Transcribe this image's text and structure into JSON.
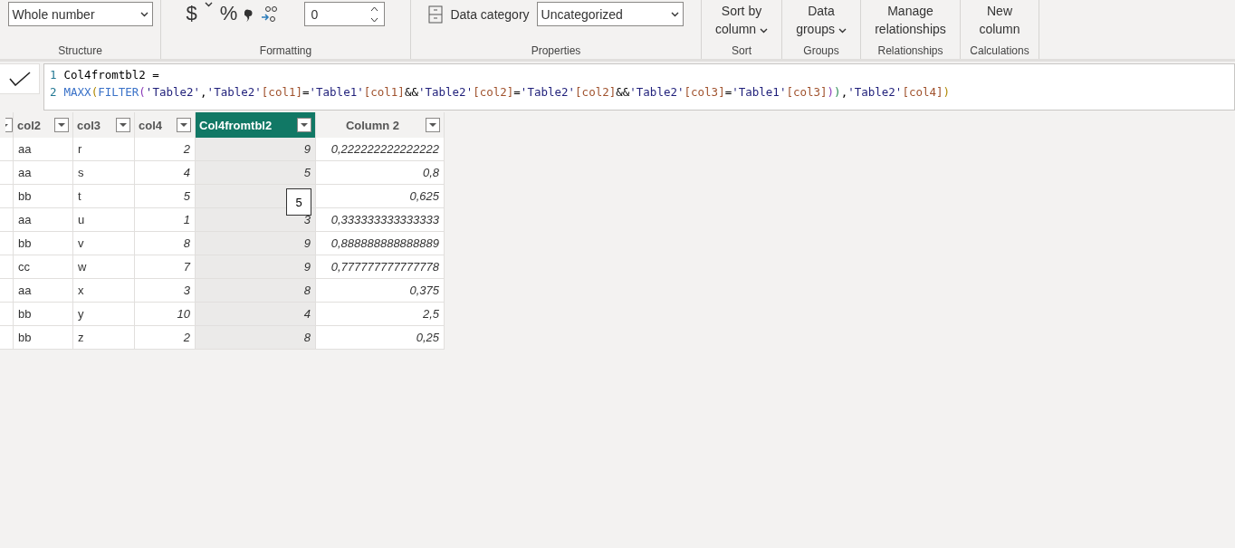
{
  "ribbon": {
    "groups": [
      {
        "kind": "structure",
        "label": "Structure",
        "select": "Whole number"
      },
      {
        "kind": "formatting",
        "label": "Formatting",
        "symbols": [
          "$",
          "%"
        ],
        "decimals": "0"
      },
      {
        "kind": "properties",
        "label": "Properties",
        "category_label": "Data category",
        "select": "Uncategorized"
      },
      {
        "kind": "button",
        "label": "Sort",
        "button": [
          "Sort by",
          "column"
        ],
        "dropdown": true
      },
      {
        "kind": "button",
        "label": "Groups",
        "button": [
          "Data",
          "groups"
        ],
        "dropdown": true
      },
      {
        "kind": "button",
        "label": "Relationships",
        "button": [
          "Manage",
          "relationships"
        ],
        "dropdown": false
      },
      {
        "kind": "button",
        "label": "Calculations",
        "button": [
          "New",
          "column"
        ],
        "dropdown": false
      }
    ]
  },
  "formula": {
    "lines": [
      {
        "number": "1",
        "tokens": [
          {
            "text": "Col4fromtbl2 =",
            "kind": "plain"
          }
        ]
      },
      {
        "number": "2",
        "tokens": [
          {
            "text": "MAXX",
            "kind": "function"
          },
          {
            "text": "(",
            "kind": "paren1"
          },
          {
            "text": "FILTER",
            "kind": "function"
          },
          {
            "text": "(",
            "kind": "paren2"
          },
          {
            "text": "'Table2'",
            "kind": "table"
          },
          {
            "text": ",",
            "kind": "plain"
          },
          {
            "text": "'Table2'",
            "kind": "table"
          },
          {
            "text": "[col1]",
            "kind": "column"
          },
          {
            "text": "=",
            "kind": "plain"
          },
          {
            "text": "'Table1'",
            "kind": "table"
          },
          {
            "text": "[col1]",
            "kind": "column"
          },
          {
            "text": "&&",
            "kind": "plain"
          },
          {
            "text": "'Table2'",
            "kind": "table"
          },
          {
            "text": "[col2]",
            "kind": "column"
          },
          {
            "text": "=",
            "kind": "plain"
          },
          {
            "text": "'Table2'",
            "kind": "table"
          },
          {
            "text": "[col2]",
            "kind": "column"
          },
          {
            "text": "&&",
            "kind": "plain"
          },
          {
            "text": "'Table2'",
            "kind": "table"
          },
          {
            "text": "[col3]",
            "kind": "column"
          },
          {
            "text": "=",
            "kind": "plain"
          },
          {
            "text": "'Table1'",
            "kind": "table"
          },
          {
            "text": "[col3]",
            "kind": "column"
          },
          {
            "text": ")",
            "kind": "paren2"
          },
          {
            "text": ")",
            "kind": "paren3"
          },
          {
            "text": ",",
            "kind": "plain"
          },
          {
            "text": "'Table2'",
            "kind": "table"
          },
          {
            "text": "[col4]",
            "kind": "column"
          },
          {
            "text": ")",
            "kind": "paren1"
          }
        ]
      }
    ]
  },
  "table": {
    "columns": [
      {
        "name": "col2",
        "kind": "text",
        "selected": false
      },
      {
        "name": "col3",
        "kind": "text",
        "selected": false
      },
      {
        "name": "col4",
        "kind": "number",
        "selected": false
      },
      {
        "name": "Col4fromtbl2",
        "kind": "number",
        "selected": true
      },
      {
        "name": "Column 2",
        "kind": "number",
        "selected": false
      }
    ],
    "rows": [
      [
        "aa",
        "r",
        "2",
        "9",
        "0,222222222222222"
      ],
      [
        "aa",
        "s",
        "4",
        "5",
        "0,8"
      ],
      [
        "bb",
        "t",
        "5",
        "",
        "0,625"
      ],
      [
        "aa",
        "u",
        "1",
        "3",
        "0,333333333333333"
      ],
      [
        "bb",
        "v",
        "8",
        "9",
        "0,888888888888889"
      ],
      [
        "cc",
        "w",
        "7",
        "9",
        "0,777777777777778"
      ],
      [
        "aa",
        "x",
        "3",
        "8",
        "0,375"
      ],
      [
        "bb",
        "y",
        "10",
        "4",
        "2,5"
      ],
      [
        "bb",
        "z",
        "2",
        "8",
        "0,25"
      ]
    ],
    "tooltip": {
      "text": "5"
    }
  }
}
